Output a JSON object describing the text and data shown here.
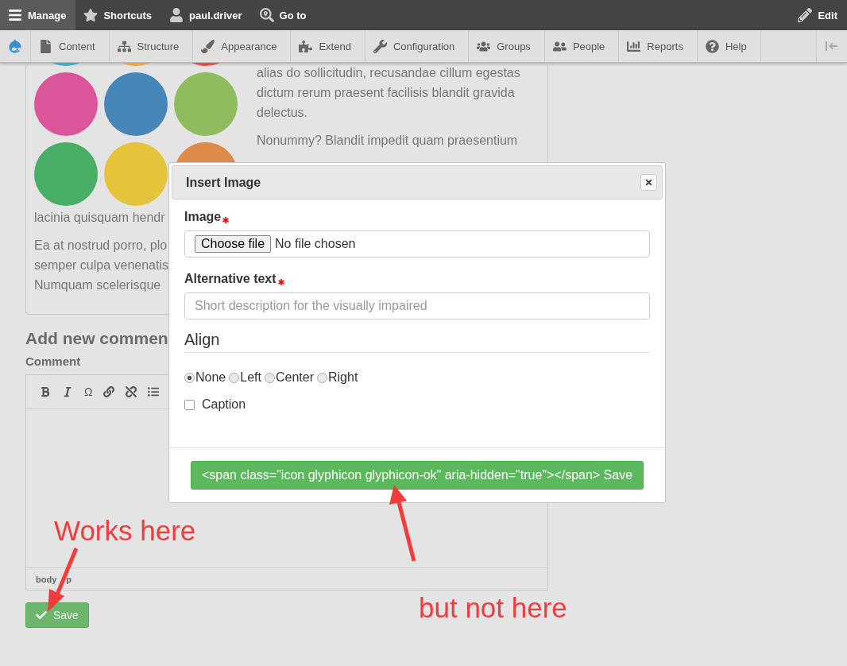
{
  "toolbar": {
    "items": [
      {
        "label": "Manage",
        "selected": true
      },
      {
        "label": "Shortcuts",
        "selected": false
      },
      {
        "label": "paul.driver",
        "selected": false
      },
      {
        "label": "Go to",
        "selected": false
      }
    ],
    "edit": "Edit"
  },
  "admin_menu": {
    "items": [
      {
        "label": "Content"
      },
      {
        "label": "Structure"
      },
      {
        "label": "Appearance"
      },
      {
        "label": "Extend"
      },
      {
        "label": "Configuration"
      },
      {
        "label": "Groups"
      },
      {
        "label": "People"
      },
      {
        "label": "Reports"
      },
      {
        "label": "Help"
      }
    ]
  },
  "article": {
    "side_paragraphs": [
      "alias do sollicitudin, recusandae cillum egestas dictum rerum praesent facilisis blandit gravida delectus.",
      "Nonummy? Blandit impedit quam praesentium"
    ],
    "below_paragraphs": [
      [
        "lacinia quisquam hendr"
      ],
      [
        "Ea at nostrud porro, plo",
        "semper culpa venenatis",
        "Numquam scelerisque"
      ]
    ]
  },
  "comment_form": {
    "special_char": "Ω",
    "heading": "Add new commen",
    "label": "Comment",
    "status_path": [
      "body",
      "p"
    ],
    "save": "Save"
  },
  "dialog": {
    "title": "Insert Image",
    "image": {
      "label": "Image",
      "required": true,
      "button": "Choose file",
      "status": "No file chosen"
    },
    "alt": {
      "label": "Alternative text",
      "required": true,
      "placeholder": "Short description for the visually impaired"
    },
    "align": {
      "legend": "Align",
      "options": [
        {
          "label": "None",
          "selected": true
        },
        {
          "label": "Left",
          "selected": false
        },
        {
          "label": "Center",
          "selected": false
        },
        {
          "label": "Right",
          "selected": false
        }
      ]
    },
    "caption": {
      "label": "Caption",
      "checked": false
    },
    "save": "<span class=\"icon glyphicon glyphicon-ok\" aria-hidden=\"true\"></span> Save"
  },
  "annotations": [
    {
      "text": "Works here"
    },
    {
      "text": "but not here"
    }
  ]
}
